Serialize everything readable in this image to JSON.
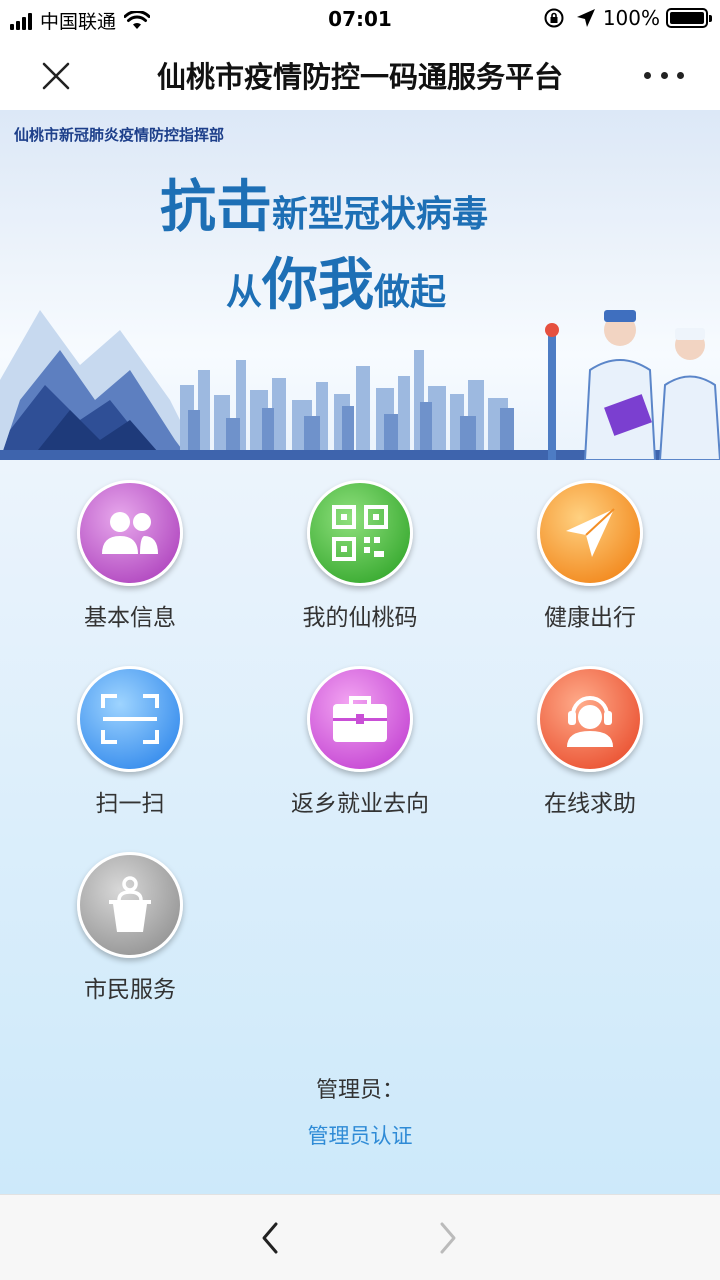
{
  "status_bar": {
    "carrier": "中国联通",
    "time": "07:01",
    "battery": "100%",
    "signal_icon": "signal-bars-icon",
    "wifi_icon": "wifi-icon",
    "lock_icon": "rotation-lock-icon",
    "location_icon": "location-arrow-icon"
  },
  "nav": {
    "title": "仙桃市疫情防控一码通服务平台",
    "close_icon": "close-icon",
    "more_icon": "more-dots-icon"
  },
  "banner": {
    "org": "仙桃市新冠肺炎疫情防控指挥部",
    "line1_big": "抗击",
    "line1_small": "新型冠状病毒",
    "line2_small_a": "从",
    "line2_big": "你我",
    "line2_small_b": "做起"
  },
  "tiles": [
    {
      "label": "基本信息",
      "icon": "people-icon",
      "color": "#b54fc3"
    },
    {
      "label": "我的仙桃码",
      "icon": "qr-code-icon",
      "color": "#3fae36"
    },
    {
      "label": "健康出行",
      "icon": "paper-plane-icon",
      "color": "#f38e25"
    },
    {
      "label": "扫一扫",
      "icon": "scan-icon",
      "color": "#3f92ee"
    },
    {
      "label": "返乡就业去向",
      "icon": "briefcase-icon",
      "color": "#c94fd6"
    },
    {
      "label": "在线求助",
      "icon": "headset-agent-icon",
      "color": "#ec5a3a"
    },
    {
      "label": "市民服务",
      "icon": "podium-person-icon",
      "color": "#9a9a9a"
    }
  ],
  "admin": {
    "label": "管理员：",
    "link": "管理员认证"
  },
  "toolbar": {
    "back_icon": "chevron-left-icon",
    "forward_icon": "chevron-right-icon"
  }
}
